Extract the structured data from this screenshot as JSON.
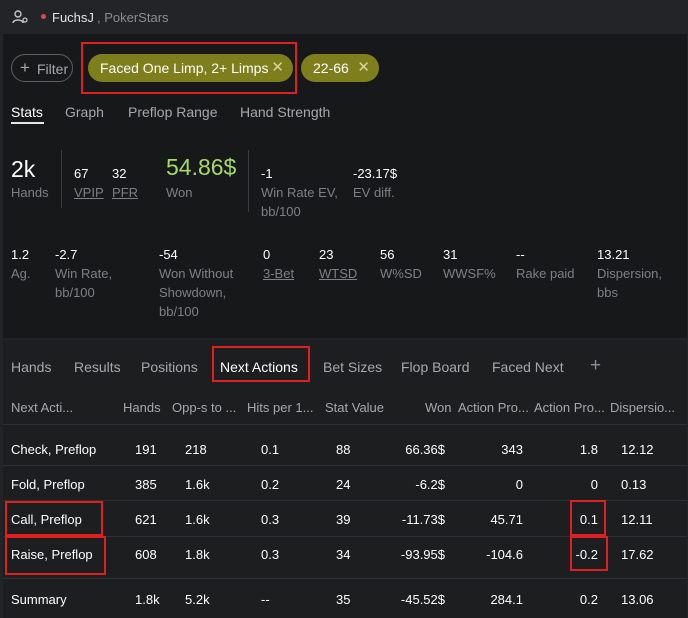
{
  "user": {
    "name": "FuchsJ",
    "site": ", PokerStars"
  },
  "filters": {
    "add_label": "Filter",
    "chips": [
      {
        "label": "Faced One Limp, 2+ Limps"
      },
      {
        "label": "22-66"
      }
    ]
  },
  "stats_tabs": [
    "Stats",
    "Graph",
    "Preflop Range",
    "Hand Strength"
  ],
  "stats_row1": {
    "hands": {
      "value": "2k",
      "label": "Hands"
    },
    "vpip": {
      "value": "67",
      "label": "VPIP"
    },
    "pfr": {
      "value": "32",
      "label": "PFR"
    },
    "won": {
      "value": "54.86$",
      "label": "Won"
    },
    "win_rate_ev": {
      "value": "-1",
      "label_l1": "Win Rate EV,",
      "label_l2": "bb/100"
    },
    "ev_diff": {
      "value": "-23.17$",
      "label": "EV diff."
    }
  },
  "stats_row2": {
    "ag": {
      "value": "1.2",
      "label": "Ag."
    },
    "win_rate": {
      "value": "-2.7",
      "label_l1": "Win Rate,",
      "label_l2": "bb/100"
    },
    "wwsd": {
      "value": "-54",
      "label_l1": "Won Without",
      "label_l2": "Showdown,",
      "label_l3": "bb/100"
    },
    "three_bet": {
      "value": "0",
      "label": "3-Bet"
    },
    "wtsd": {
      "value": "23",
      "label": "WTSD"
    },
    "wsd": {
      "value": "56",
      "label": "W%SD"
    },
    "wwsf": {
      "value": "31",
      "label": "WWSF%"
    },
    "rake": {
      "value": "--",
      "label": "Rake paid"
    },
    "dispersion": {
      "value": "13.21",
      "label_l1": "Dispersion,",
      "label_l2": "bbs"
    }
  },
  "lower_tabs": [
    "Hands",
    "Results",
    "Positions",
    "Next Actions",
    "Bet Sizes",
    "Flop Board",
    "Faced Next"
  ],
  "add_tab": "+",
  "table": {
    "headers": [
      "Next Acti...",
      "Hands",
      "Opp-s to ...",
      "Hits per 1...",
      "Stat Value",
      "Won",
      "Action Pro...",
      "Action Pro...",
      "Dispersio..."
    ],
    "rows": [
      {
        "action": "Check, Preflop",
        "hands": "191",
        "opps": "218",
        "hits": "0.1",
        "stat": "88",
        "won": "66.36$",
        "ap1": "343",
        "ap2": "1.8",
        "disp": "12.12"
      },
      {
        "action": "Fold, Preflop",
        "hands": "385",
        "opps": "1.6k",
        "hits": "0.2",
        "stat": "24",
        "won": "-6.2$",
        "ap1": "0",
        "ap2": "0",
        "disp": "0.13"
      },
      {
        "action": "Call, Preflop",
        "hands": "621",
        "opps": "1.6k",
        "hits": "0.3",
        "stat": "39",
        "won": "-11.73$",
        "ap1": "45.71",
        "ap2": "0.1",
        "disp": "12.11"
      },
      {
        "action": "Raise, Preflop",
        "hands": "608",
        "opps": "1.8k",
        "hits": "0.3",
        "stat": "34",
        "won": "-93.95$",
        "ap1": "-104.6",
        "ap2": "-0.2",
        "disp": "17.62"
      }
    ],
    "summary": {
      "label": "Summary",
      "hands": "1.8k",
      "opps": "5.2k",
      "hits": "--",
      "stat": "35",
      "won": "-45.52$",
      "ap1": "284.1",
      "ap2": "0.2",
      "disp": "13.06"
    }
  },
  "colors": {
    "positive": "#a8d86a",
    "negative": "#ec7a6b",
    "chip": "#7f7e1c",
    "highlight": "#e02020"
  }
}
